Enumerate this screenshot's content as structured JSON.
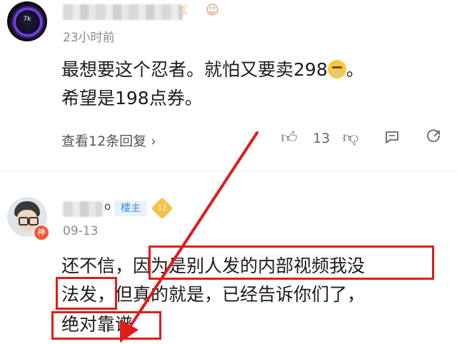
{
  "comment1": {
    "avatar_text": "7k",
    "time": "23小时前",
    "content_line1_a": "最想要这个忍者。就怕又要卖298",
    "emoji": "sneeze-face",
    "content_line1_b": "。",
    "content_line2": "希望是198点券。",
    "replies": "查看12条回复",
    "chevron": "›",
    "like_count": "13"
  },
  "comment2": {
    "name_suffix": "o",
    "op_tag": "楼主",
    "level": "12",
    "avatar_badge": "神",
    "time": "09-13",
    "line1_a": "还不信，",
    "line1_b": "因为是别人发的内部视频我没",
    "line2_a": "法发，",
    "line2_b": "但真的就是，已经告诉你们了，",
    "line3": "绝对靠谱"
  },
  "annotation": {
    "color": "#e01c1c"
  }
}
